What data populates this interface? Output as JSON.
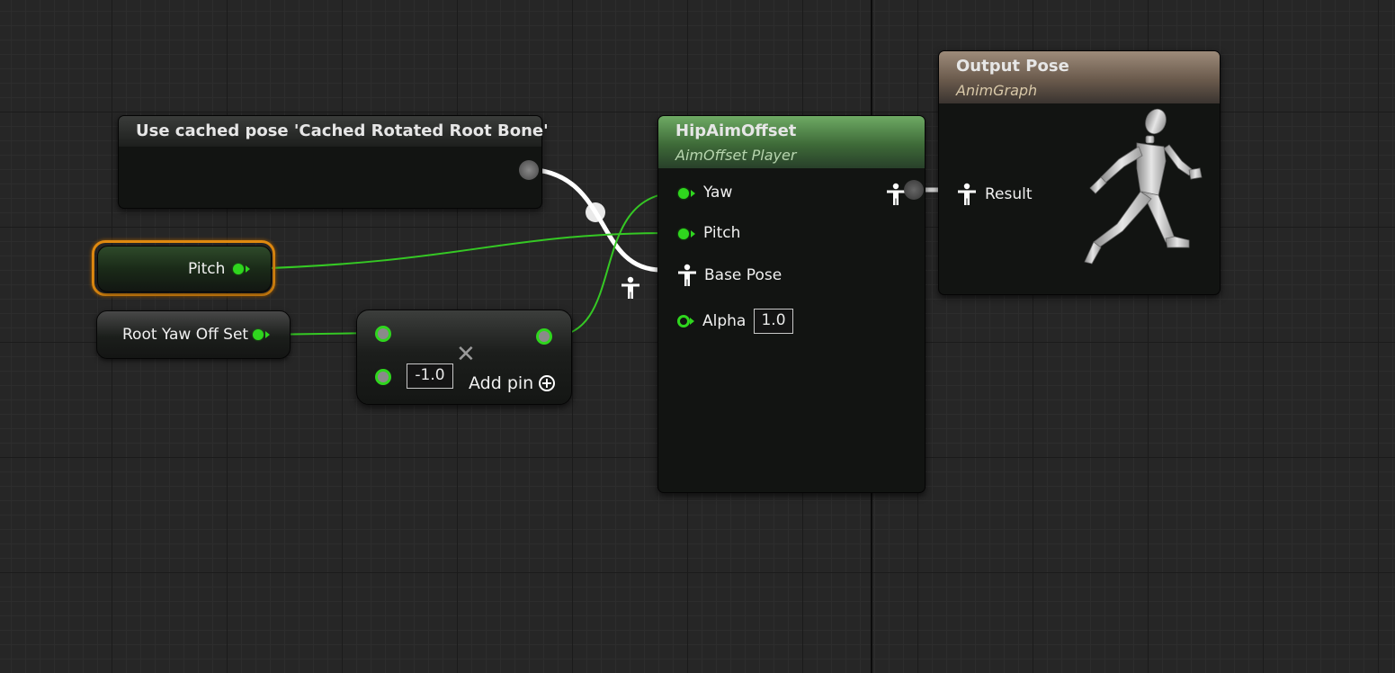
{
  "nodes": {
    "cached_pose": {
      "title": "Use cached pose 'Cached Rotated Root Bone'"
    },
    "pitch_var": {
      "label": "Pitch"
    },
    "root_yaw_var": {
      "label": "Root Yaw Off Set"
    },
    "multiply": {
      "value": "-1.0",
      "add_pin_label": "Add pin"
    },
    "aim_offset": {
      "title": "HipAimOffset",
      "subtitle": "AimOffset Player",
      "pins": {
        "yaw": "Yaw",
        "pitch": "Pitch",
        "base_pose": "Base Pose",
        "alpha": "Alpha",
        "alpha_value": "1.0"
      }
    },
    "output_pose": {
      "title": "Output Pose",
      "subtitle": "AnimGraph",
      "pins": {
        "result": "Result"
      }
    }
  },
  "colors": {
    "float_pin": "#2fd61e",
    "aim_offset_header": "#5f9a58",
    "output_pose_header": "#8a7a6a",
    "selection_outline": "#e08a10",
    "background": "#262626"
  },
  "icons": [
    "pose-icon",
    "close-icon",
    "add-circle-icon",
    "mannequin-icon"
  ]
}
